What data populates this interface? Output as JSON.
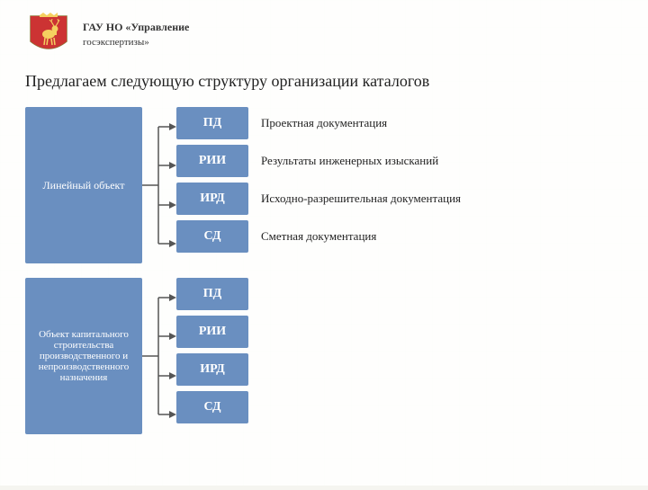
{
  "header": {
    "org_line1": "ГАУ НО «Управление",
    "org_line2": "госэкспертизы»"
  },
  "page_title": "Предлагаем следующую структуру организации каталогов",
  "rows": [
    {
      "id": "linear",
      "category_label": "Линейный объект",
      "sub_items": [
        {
          "code": "ПД",
          "label": "Проектная документация"
        },
        {
          "code": "РИИ",
          "label": "Результаты инженерных изысканий"
        },
        {
          "code": "ИРД",
          "label": "Исходно-разрешительная документация"
        },
        {
          "code": "СД",
          "label": "Сметная документация"
        }
      ]
    },
    {
      "id": "capital",
      "category_label": "Объект капитального строительства производственного и непроизводственного назначения",
      "sub_items": [
        {
          "code": "ПД",
          "label": ""
        },
        {
          "code": "РИИ",
          "label": ""
        },
        {
          "code": "ИРД",
          "label": ""
        },
        {
          "code": "СД",
          "label": ""
        }
      ]
    }
  ],
  "colors": {
    "box_bg": "#7b9ec9",
    "box_text": "#ffffff",
    "arrow": "#555555"
  }
}
